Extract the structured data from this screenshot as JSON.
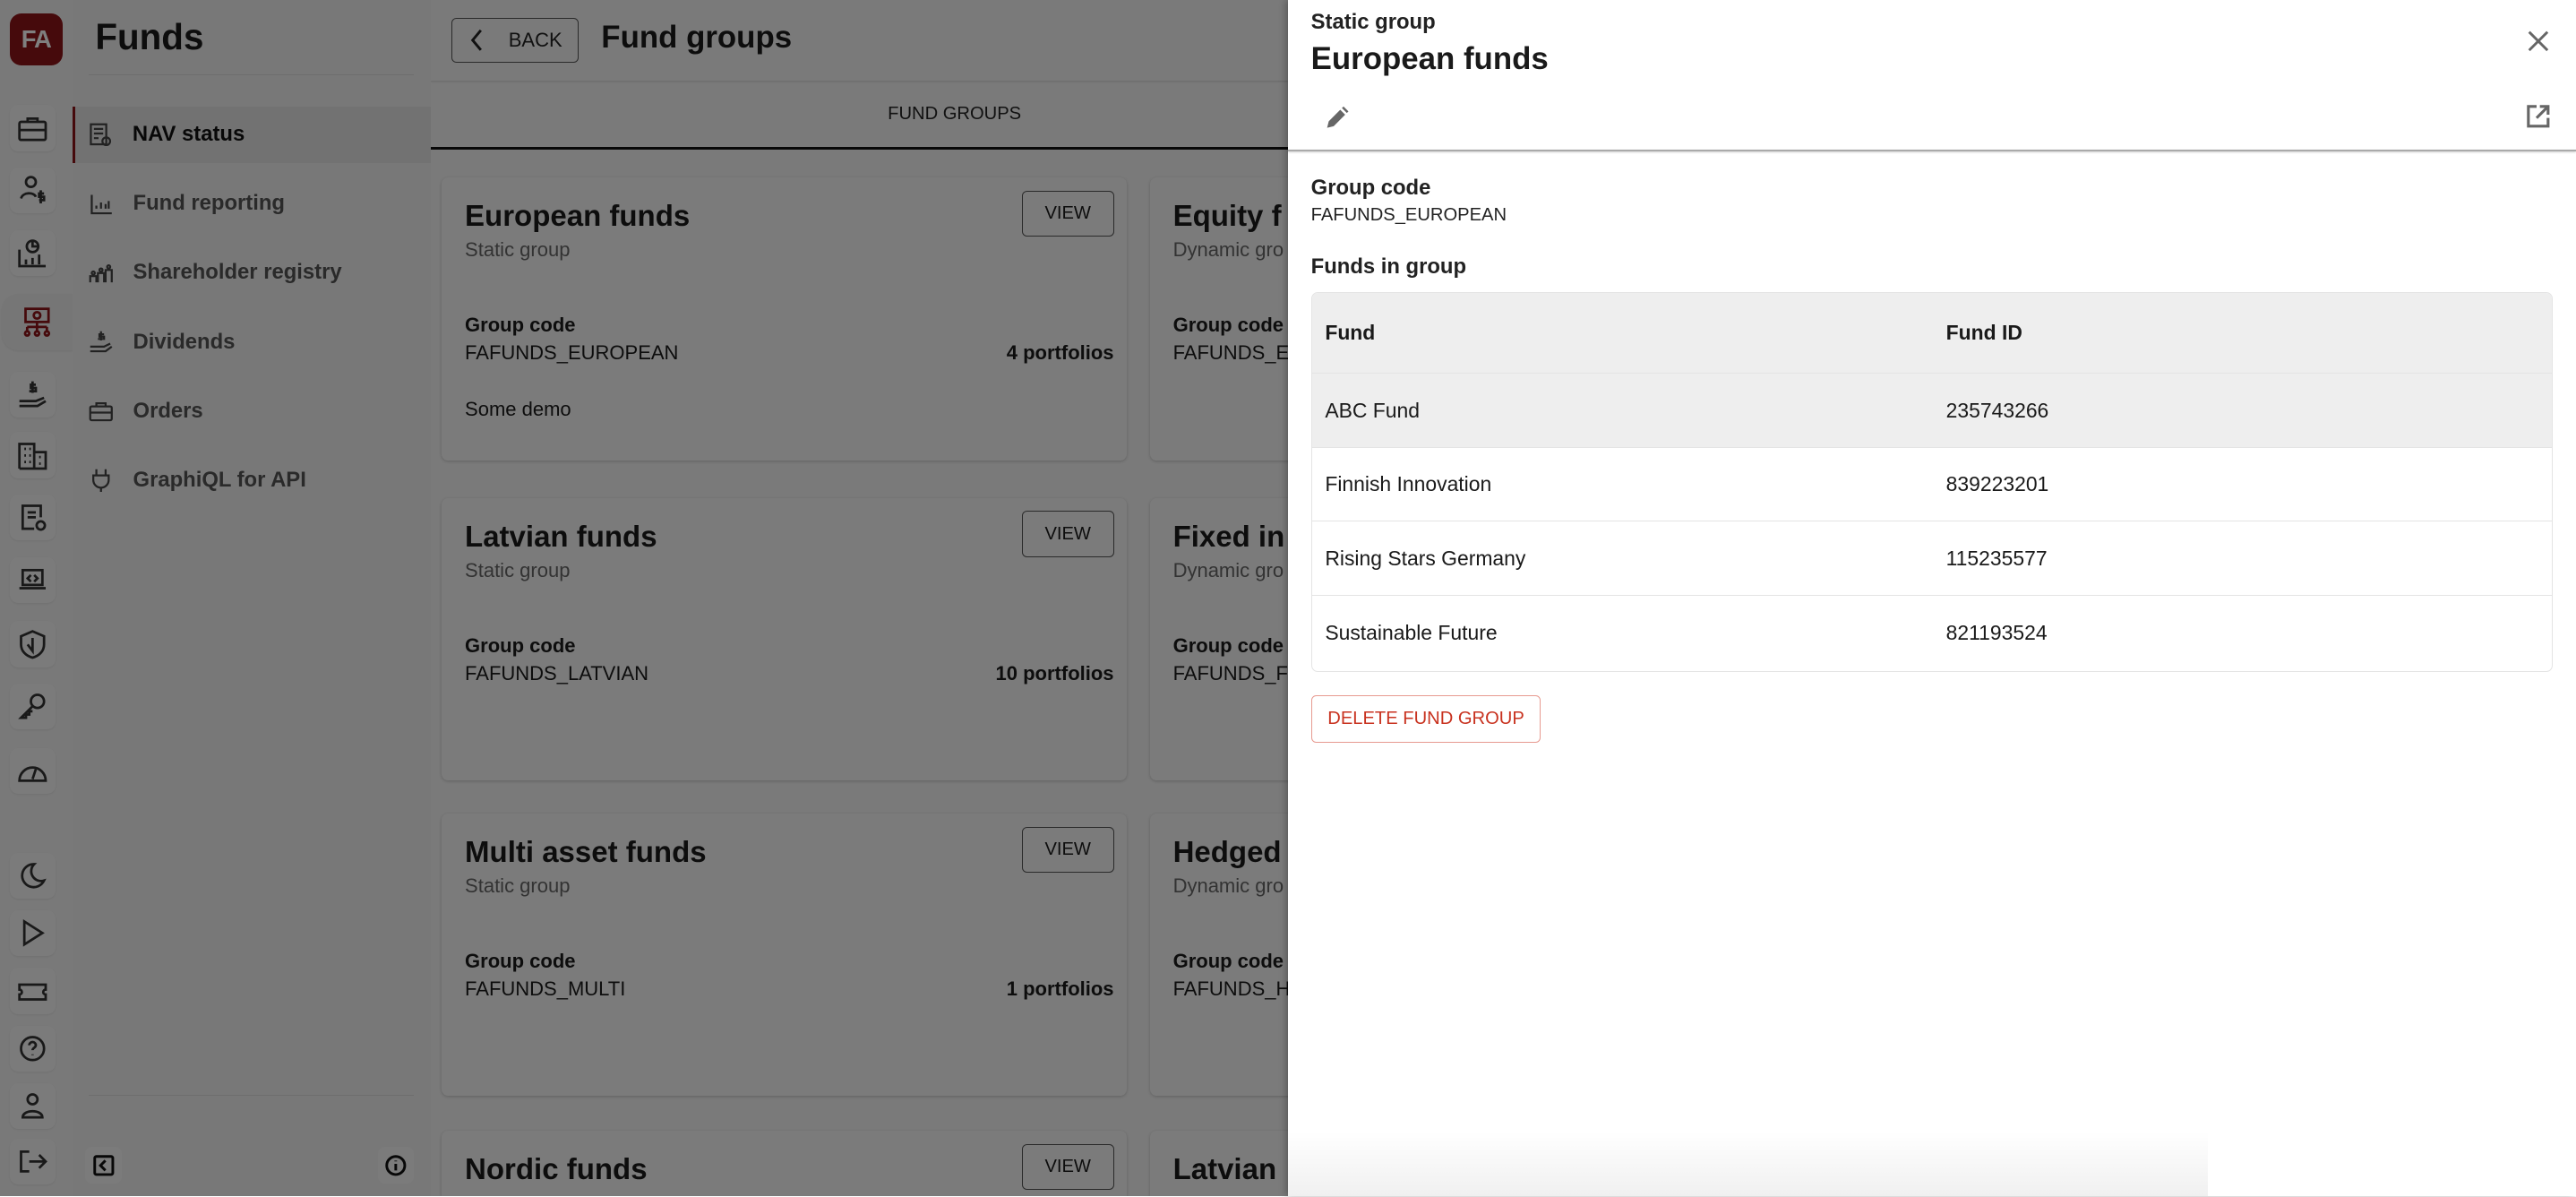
{
  "app": {
    "logo_text": "FA",
    "brand_color": "#8c1419"
  },
  "rail": {
    "items": [
      {
        "icon": "briefcase-icon"
      },
      {
        "icon": "person-dollar-icon"
      },
      {
        "icon": "chart-pie-bars-icon"
      },
      {
        "icon": "fund-structure-icon",
        "active": true
      },
      {
        "icon": "hand-dollar-icon"
      },
      {
        "icon": "building-icon"
      },
      {
        "icon": "document-settings-icon"
      },
      {
        "icon": "laptop-code-icon"
      },
      {
        "icon": "shield-icon"
      },
      {
        "icon": "key-icon"
      },
      {
        "icon": "gauge-icon"
      }
    ],
    "bottom": [
      {
        "icon": "moon-icon"
      },
      {
        "icon": "play-icon"
      },
      {
        "icon": "ticket-icon"
      },
      {
        "icon": "help-icon"
      },
      {
        "icon": "user-icon"
      },
      {
        "icon": "logout-icon"
      }
    ]
  },
  "sidebar": {
    "title": "Funds",
    "items": [
      {
        "label": "NAV status",
        "icon": "nav-status-icon",
        "active": true
      },
      {
        "label": "Fund reporting",
        "icon": "bar-chart-icon"
      },
      {
        "label": "Shareholder registry",
        "icon": "shareholders-icon"
      },
      {
        "label": "Dividends",
        "icon": "hand-dollar-icon"
      },
      {
        "label": "Orders",
        "icon": "briefcase-icon"
      },
      {
        "label": "GraphiQL for API",
        "icon": "plug-icon"
      }
    ]
  },
  "main": {
    "back_label": "BACK",
    "title": "Fund groups",
    "tab": "FUND GROUPS",
    "view_label": "VIEW",
    "group_code_label": "Group code",
    "cards": [
      {
        "title": "European funds",
        "type": "Static group",
        "code": "FAFUNDS_EUROPEAN",
        "count": "4 portfolios",
        "description": "Some demo"
      },
      {
        "title": "Equity f",
        "type": "Dynamic gro",
        "code": "FAFUNDS_E"
      },
      {
        "title": "Latvian funds",
        "type": "Static group",
        "code": "FAFUNDS_LATVIAN",
        "count": "10 portfolios"
      },
      {
        "title": "Fixed in",
        "type": "Dynamic gro",
        "code": "FAFUNDS_F"
      },
      {
        "title": "Multi asset funds",
        "type": "Static group",
        "code": "FAFUNDS_MULTI",
        "count": "1 portfolios"
      },
      {
        "title": "Hedged",
        "type": "Dynamic gro",
        "code": "FAFUNDS_H"
      },
      {
        "title": "Nordic funds"
      },
      {
        "title": "Latvian"
      }
    ]
  },
  "drawer": {
    "subtitle": "Static group",
    "title": "European funds",
    "group_code_label": "Group code",
    "group_code": "FAFUNDS_EUROPEAN",
    "funds_label": "Funds in group",
    "table": {
      "headers": [
        "Fund",
        "Fund ID"
      ],
      "rows": [
        [
          "ABC Fund",
          "235743266"
        ],
        [
          "Finnish Innovation",
          "839223201"
        ],
        [
          "Rising Stars Germany",
          "115235577"
        ],
        [
          "Sustainable Future",
          "821193524"
        ]
      ]
    },
    "delete_label": "DELETE FUND GROUP",
    "danger_color": "#c8321f"
  }
}
